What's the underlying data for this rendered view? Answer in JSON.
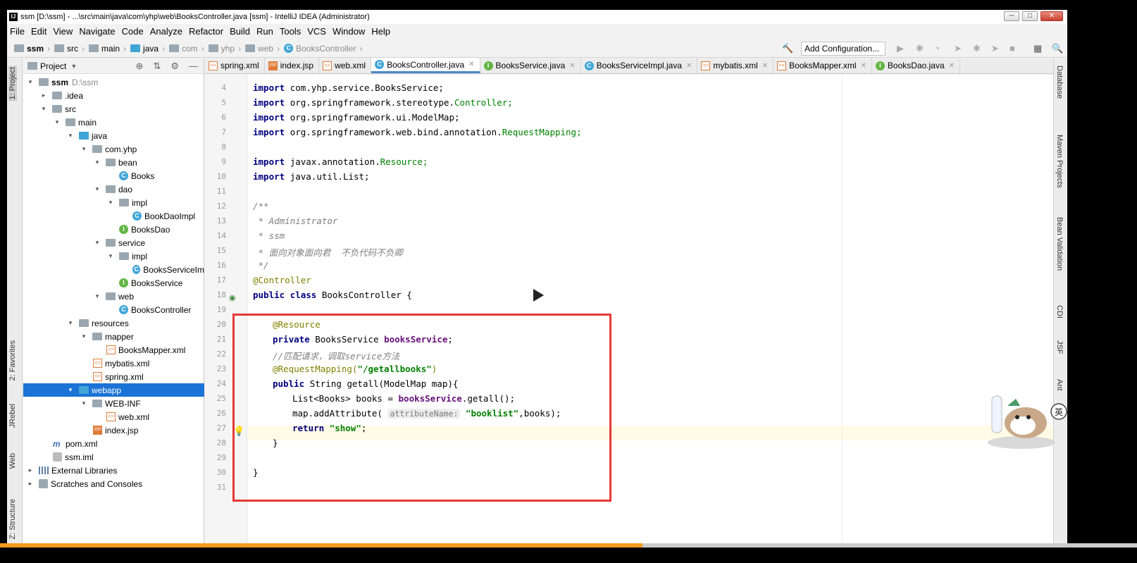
{
  "window": {
    "title": "ssm [D:\\ssm] - ...\\src\\main\\java\\com\\yhp\\web\\BooksController.java [ssm] - IntelliJ IDEA (Administrator)",
    "app_icon": "IJ",
    "controls": [
      "─",
      "□",
      "✕"
    ]
  },
  "menu": [
    "File",
    "Edit",
    "View",
    "Navigate",
    "Code",
    "Analyze",
    "Refactor",
    "Build",
    "Run",
    "Tools",
    "VCS",
    "Window",
    "Help"
  ],
  "breadcrumb": [
    "ssm",
    "src",
    "main",
    "java",
    "com",
    "yhp",
    "web",
    "BooksController"
  ],
  "toolbar": {
    "add_configuration": "Add Configuration..."
  },
  "left_tabs": {
    "project": "1: Project",
    "favorites": "2: Favorites",
    "jrebel": "JRebel",
    "web": "Web",
    "structure": "Z: Structure"
  },
  "right_tabs": {
    "database": "Database",
    "maven": "Maven Projects",
    "bean": "Bean Validation",
    "cdi": "CDI",
    "jsf": "JSF",
    "ant": "Ant"
  },
  "project": {
    "header": "Project",
    "tree": [
      {
        "label": "ssm",
        "extra": "D:\\ssm",
        "icon": "module"
      },
      {
        "label": ".idea",
        "icon": "folder"
      },
      {
        "label": "src",
        "icon": "folder"
      },
      {
        "label": "main",
        "icon": "folder"
      },
      {
        "label": "java",
        "icon": "folder-blue"
      },
      {
        "label": "com.yhp",
        "icon": "package"
      },
      {
        "label": "bean",
        "icon": "package"
      },
      {
        "label": "Books",
        "icon": "class"
      },
      {
        "label": "dao",
        "icon": "package"
      },
      {
        "label": "impl",
        "icon": "package"
      },
      {
        "label": "BookDaoImpl",
        "icon": "class"
      },
      {
        "label": "BooksDao",
        "icon": "interface"
      },
      {
        "label": "service",
        "icon": "package"
      },
      {
        "label": "impl",
        "icon": "package"
      },
      {
        "label": "BooksServiceIm",
        "icon": "class"
      },
      {
        "label": "BooksService",
        "icon": "interface"
      },
      {
        "label": "web",
        "icon": "package"
      },
      {
        "label": "BooksController",
        "icon": "class"
      },
      {
        "label": "resources",
        "icon": "folder"
      },
      {
        "label": "mapper",
        "icon": "folder"
      },
      {
        "label": "BooksMapper.xml",
        "icon": "xml"
      },
      {
        "label": "mybatis.xml",
        "icon": "xml"
      },
      {
        "label": "spring.xml",
        "icon": "xml"
      },
      {
        "label": "webapp",
        "icon": "folder-blue"
      },
      {
        "label": "WEB-INF",
        "icon": "folder"
      },
      {
        "label": "web.xml",
        "icon": "xml"
      },
      {
        "label": "index.jsp",
        "icon": "jsp"
      },
      {
        "label": "pom.xml",
        "icon": "maven"
      },
      {
        "label": "ssm.iml",
        "icon": "file"
      },
      {
        "label": "External Libraries",
        "icon": "library"
      },
      {
        "label": "Scratches and Consoles",
        "icon": "scratch"
      }
    ]
  },
  "tabs": [
    {
      "label": "spring.xml",
      "icon": "xml"
    },
    {
      "label": "index.jsp",
      "icon": "jsp"
    },
    {
      "label": "web.xml",
      "icon": "xml"
    },
    {
      "label": "BooksController.java",
      "icon": "class",
      "active": true
    },
    {
      "label": "BooksService.java",
      "icon": "interface"
    },
    {
      "label": "BooksServiceImpl.java",
      "icon": "class"
    },
    {
      "label": "mybatis.xml",
      "icon": "xml"
    },
    {
      "label": "BooksMapper.xml",
      "icon": "xml"
    },
    {
      "label": "BooksDao.java",
      "icon": "interface"
    }
  ],
  "code": {
    "line_numbers": [
      "4",
      "5",
      "6",
      "7",
      "8",
      "9",
      "10",
      "11",
      "12",
      "13",
      "14",
      "15",
      "16",
      "17",
      "18",
      "19",
      "20",
      "21",
      "22",
      "23",
      "24",
      "25",
      "26",
      "27",
      "28",
      "29",
      "30",
      "31"
    ],
    "l4_pkg": "com.yhp.service.BooksService;",
    "l5_pkg": "org.springframework.stereotype.",
    "l5_cls": "Controller;",
    "l6_pkg": "org.springframework.ui.ModelMap;",
    "l7_pkg": "org.springframework.web.bind.annotation.",
    "l7_cls": "RequestMapping;",
    "l9_pkg": "javax.annotation.",
    "l9_cls": "Resource;",
    "l10_pkg": "java.util.List;",
    "kw_import": "import",
    "l12": "/**",
    "l13": " * Administrator",
    "l14": " * ssm",
    "l15": " * 面向对象面向君  不负代码不负卿",
    "l16": " */",
    "l17": "@Controller",
    "kw_public": "public",
    "kw_class": "class",
    "l18_name": "BooksController {",
    "l20": "@Resource",
    "kw_private": "private",
    "l21_type": "BooksService",
    "l21_field": "booksService",
    "semicolon": ";",
    "l22": "//匹配请求，调取service方法",
    "l23_ann": "@RequestMapping(",
    "l23_str": "\"/getallbooks\"",
    "l23_end": ")",
    "l24_rest": "String getall(ModelMap map){",
    "l25_a": "List<Books> books = ",
    "l25_field": "booksService",
    "l25_b": ".getall();",
    "l26_a": "map.addAttribute(",
    "l26_hint": "attributeName:",
    "l26_str": "\"booklist\"",
    "l26_b": ",books);",
    "kw_return": "return",
    "l27_str": "\"show\"",
    "l28": "}",
    "l30": "}"
  },
  "progress": 0.565
}
